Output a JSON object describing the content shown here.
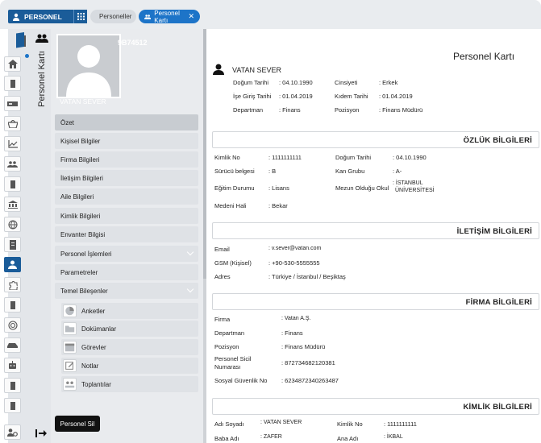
{
  "topbar": {
    "app_label": "PERSONEL",
    "tabs": [
      {
        "label": "Personeller"
      },
      {
        "label": "Personel Kartı"
      }
    ]
  },
  "sidebar_title": "Personel Kartı",
  "hero": {
    "id": "9B74512",
    "name": "VATAN SEVER"
  },
  "menu": {
    "items": [
      {
        "label": "Özet"
      },
      {
        "label": "Kişisel Bilgiler"
      },
      {
        "label": "Firma Bilgileri"
      },
      {
        "label": "İletişim Bilgileri"
      },
      {
        "label": "Aile Bilgileri"
      },
      {
        "label": "Kimlik Bilgileri"
      },
      {
        "label": "Envanter Bilgisi"
      },
      {
        "label": "Personel İşlemleri"
      },
      {
        "label": "Parametreler"
      },
      {
        "label": "Temel Bileşenler"
      }
    ],
    "sub_items": [
      {
        "label": "Anketler"
      },
      {
        "label": "Dokümanlar"
      },
      {
        "label": "Görevler"
      },
      {
        "label": "Notlar"
      },
      {
        "label": "Toplantılar"
      }
    ],
    "delete_label": "Personel Sil"
  },
  "card": {
    "title": "Personel Kartı",
    "person_name": "VATAN SEVER",
    "summary": {
      "birth_label": "Doğum Tarihi",
      "birth_value": ": 04.10.1990",
      "gender_label": "Cinsiyeti",
      "gender_value": ": Erkek",
      "start_label": "İşe Giriş Tarihi",
      "start_value": ": 01.04.2019",
      "seniority_label": "Kıdem Tarihi",
      "seniority_value": ": 01.04.2019",
      "dept_label": "Departman",
      "dept_value": ": Finans",
      "pos_label": "Pozisyon",
      "pos_value": ": Finans Müdürü"
    }
  },
  "ozluk": {
    "title": "ÖZLÜK BİLGİLERİ",
    "kimlik_label": "Kimlik No",
    "kimlik_value": ": 1111111111",
    "dogum_label": "Doğum Tarihi",
    "dogum_value": ": 04.10.1990",
    "surucu_label": "Sürücü belgesi",
    "surucu_value": ": B",
    "kan_label": "Kan Grubu",
    "kan_value": ": A-",
    "egitim_label": "Eğitim Durumu",
    "egitim_value": ": Lisans",
    "mezun_label": "Mezun Olduğu Okul",
    "mezun_value_1": ": İSTANBUL",
    "mezun_value_2": "ÜNİVERSİTESİ",
    "medeni_label": "Medeni Hali",
    "medeni_value": ": Bekar"
  },
  "iletisim": {
    "title": "İLETİŞİM BİLGİLERİ",
    "email_label": "Email",
    "email_value": ": v.sever@vatan.com",
    "gsm_label": "GSM (Kişisel)",
    "gsm_value": ": +90-530-5555555",
    "adres_label": "Adres",
    "adres_value": ": Türkiye / İstanbul / Beşiktaş"
  },
  "firma": {
    "title": "FİRMA BİLGİLERİ",
    "firma_label": "Firma",
    "firma_value": ": Vatan A.Ş.",
    "dept_label": "Departman",
    "dept_value": ": Finans",
    "pos_label": "Pozisyon",
    "pos_value": ": Finans Müdürü",
    "sicil_label_1": "Personel Sicil",
    "sicil_label_2": "Numarası",
    "sicil_value": ": 872734682120381",
    "sgk_label": "Sosyal Güvenlik No",
    "sgk_value": ": 6234872340263487"
  },
  "kimlik": {
    "title": "KİMLİK BİLGİLERİ",
    "adsoyad_label": "Adı Soyadı",
    "adsoyad_value": ": VATAN SEVER",
    "kimlikno_label": "Kimlik No",
    "kimlikno_value": ": 1111111111",
    "baba_label": "Baba Adı",
    "baba_value": ": ZAFER",
    "ana_label": "Ana Adı",
    "ana_value": ": İKBAL"
  },
  "colors": {
    "brand": "#1a5c99",
    "accent": "#1d74c8"
  }
}
